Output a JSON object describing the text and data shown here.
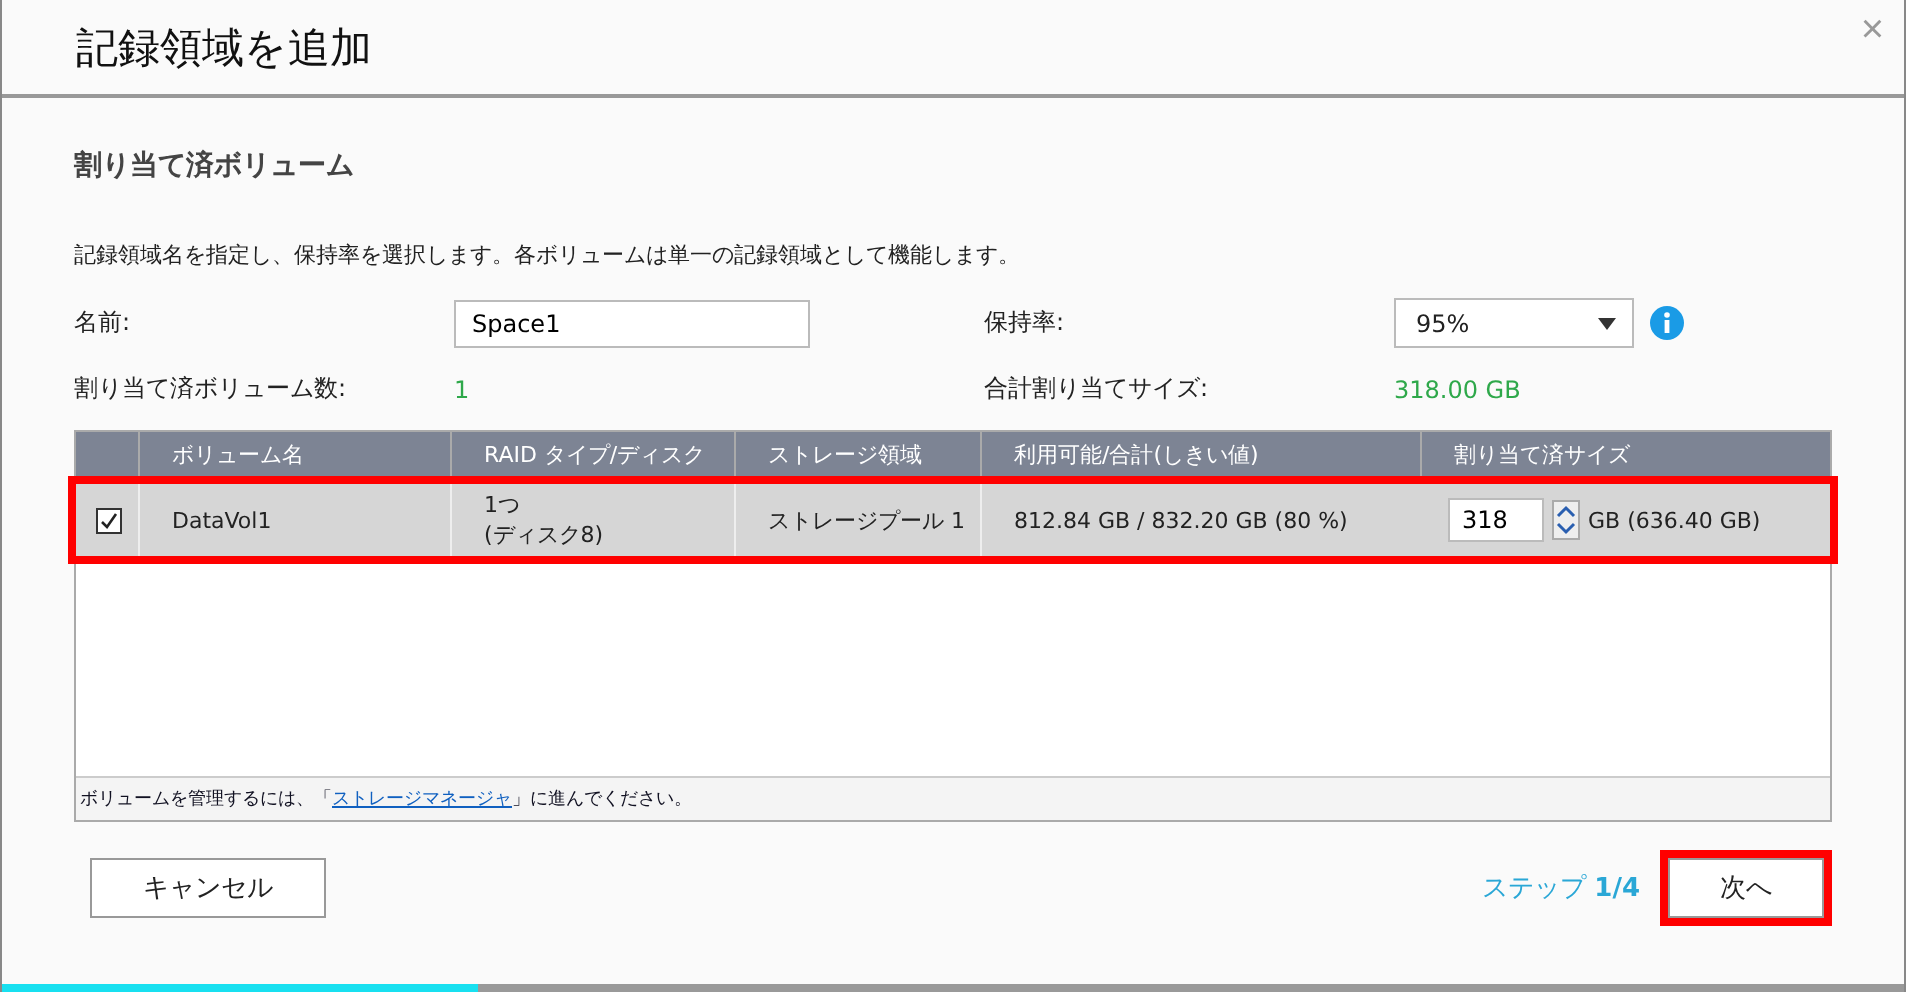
{
  "dialog": {
    "title": "記録領域を追加",
    "close": "×"
  },
  "section_title": "割り当て済ボリューム",
  "description": "記録領域名を指定し、保持率を選択します。各ボリュームは単一の記録領域として機能します。",
  "form": {
    "name_label": "名前:",
    "name_value": "Space1",
    "retention_label": "保持率:",
    "retention_value": "95%",
    "count_label": "割り当て済ボリューム数:",
    "count_value": "1",
    "total_label": "合計割り当てサイズ:",
    "total_value": "318.00 GB"
  },
  "table": {
    "columns": [
      "ボリューム名",
      "RAID タイプ/ディスク",
      "ストレージ領域",
      "利用可能/合計(しきい値)",
      "割り当て済サイズ"
    ],
    "rows": [
      {
        "checked": true,
        "highlighted": true,
        "name": "DataVol1",
        "raid": "1つ",
        "disks": "(ディスク8)",
        "pool": "ストレージプール 1",
        "capacity": "812.84 GB / 832.20 GB (80 %)",
        "size_value": "318",
        "size_unit": "GB (636.40 GB)"
      }
    ],
    "footer_before": "ボリュームを管理するには、「",
    "footer_link": "ストレージマネージャ",
    "footer_after": "」に進んでください。"
  },
  "buttons": {
    "cancel": "キャンセル",
    "next": "次へ",
    "next_highlighted": true
  },
  "step": {
    "label": "ステップ",
    "value": "1/4"
  },
  "progress": {
    "level": 0.25
  }
}
